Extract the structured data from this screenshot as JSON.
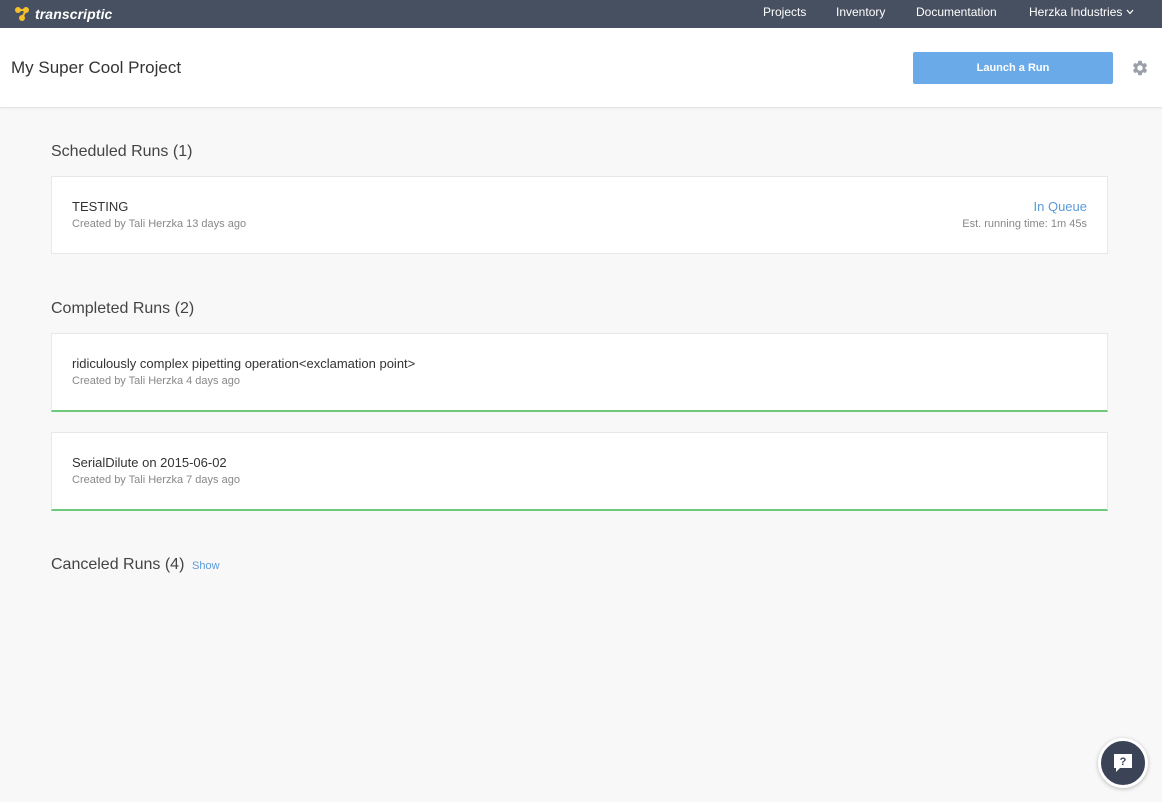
{
  "nav": {
    "logo_text": "transcriptic",
    "links": {
      "projects": "Projects",
      "inventory": "Inventory",
      "documentation": "Documentation",
      "org": "Herzka Industries"
    }
  },
  "header": {
    "project_title": "My Super Cool Project",
    "launch_label": "Launch a Run"
  },
  "scheduled": {
    "title": "Scheduled Runs (1)",
    "runs": [
      {
        "name": "TESTING",
        "meta": "Created by Tali Herzka 13 days ago",
        "status": "In Queue",
        "est": "Est. running time: 1m 45s"
      }
    ]
  },
  "completed": {
    "title": "Completed Runs (2)",
    "runs": [
      {
        "name": "ridiculously complex pipetting operation<exclamation point>",
        "meta": "Created by Tali Herzka 4 days ago"
      },
      {
        "name": "SerialDilute on 2015-06-02",
        "meta": "Created by Tali Herzka 7 days ago"
      }
    ]
  },
  "canceled": {
    "title": "Canceled Runs (4)",
    "show_label": "Show"
  },
  "help": {
    "label": "?"
  },
  "colors": {
    "nav_bg": "#475060",
    "accent_blue": "#6aaae8",
    "link_blue": "#5b9bd8",
    "completed_green": "#6dc97c",
    "logo_yellow": "#f5c02b"
  },
  "icons": {
    "logo": "transcriptic-logo-icon",
    "org_dropdown": "chevron-down-icon",
    "settings": "gear-icon",
    "help": "help-chat-icon"
  }
}
